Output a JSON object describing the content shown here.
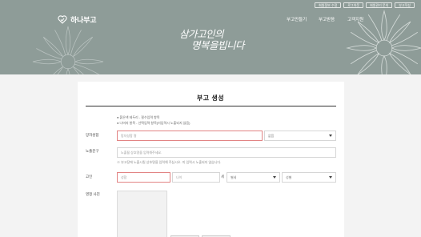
{
  "header": {
    "top_links": [
      "회원정보 수정",
      "로그아웃",
      "회원관리 문의",
      "부고작성"
    ],
    "logo_text": "하나부고",
    "nav": [
      "부고만들기",
      "부고받음",
      "고객지원"
    ],
    "slogan_line1": "삼가고인의",
    "slogan_line2": "명복을빕니다"
  },
  "page_title": "부고 생성",
  "notes": [
    "● 붉은색 테두리 - 필수입력 항목",
    "● 나머지 항목 - 선택입력 항목(미입력시 노출되지 않음)"
  ],
  "form": {
    "deceased": {
      "label": "망자성함",
      "placeholder": "망자성함 명",
      "relation_value": "없음"
    },
    "chief_mourner": {
      "label": "노출문구",
      "placeholder": "노출될 상호명을 입력해주세요."
    },
    "hint": "※ 부고장에 노출시킬 상호명을 입력해 주십시오. 미 입력시 노출되지 않습니다.",
    "age": {
      "label": "고인",
      "name_placeholder": "성함",
      "age_placeholder": "나이",
      "age_suffix": "세",
      "gender_value": "별세",
      "status_value": "성별"
    },
    "photo": {
      "label": "영정 사진"
    }
  },
  "colors": {
    "banner": "#8e9c98",
    "required_border": "#e28484",
    "background": "#f3f3f3"
  }
}
